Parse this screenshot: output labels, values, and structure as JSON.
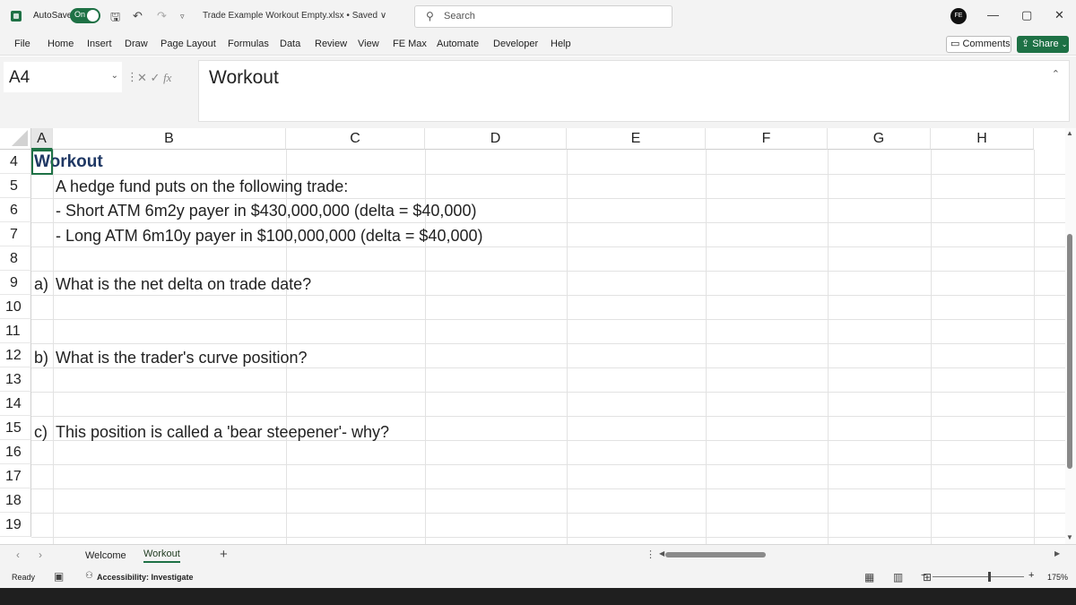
{
  "titlebar": {
    "autosave_label": "AutoSave",
    "autosave_state": "On",
    "doc_title": "Trade Example Workout Empty.xlsx • Saved ∨",
    "search_placeholder": "Search",
    "avatar_initials": "FE"
  },
  "ribbon": {
    "tabs": [
      "File",
      "Home",
      "Insert",
      "Draw",
      "Page Layout",
      "Formulas",
      "Data",
      "Review",
      "View",
      "FE Max",
      "Automate",
      "Developer",
      "Help"
    ],
    "comments_label": "Comments",
    "share_label": "Share"
  },
  "formula_bar": {
    "name_box": "A4",
    "fx_label": "fx",
    "content": "Workout"
  },
  "grid": {
    "columns": [
      "A",
      "B",
      "C",
      "D",
      "E",
      "F",
      "G",
      "H"
    ],
    "rows": [
      "4",
      "5",
      "6",
      "7",
      "8",
      "9",
      "10",
      "11",
      "12",
      "13",
      "14",
      "15",
      "16",
      "17",
      "18",
      "19"
    ],
    "cells": {
      "A4": "Workout",
      "B5": "A hedge fund puts on the following trade:",
      "B6": "- Short ATM 6m2y payer in $430,000,000 (delta = $40,000)",
      "B7": "- Long ATM 6m10y payer in $100,000,000 (delta = $40,000)",
      "A9": "a)",
      "B9": "What is the net delta on trade date?",
      "A12": "b)",
      "B12": "What is the trader's curve position?",
      "A15": "c)",
      "B15": "This position is called a 'bear steepener'- why?"
    }
  },
  "sheets": {
    "tabs": [
      "Welcome",
      "Workout"
    ],
    "active": "Workout"
  },
  "status": {
    "ready": "Ready",
    "accessibility": "Accessibility: Investigate",
    "zoom": "175%"
  },
  "colors": {
    "accent": "#1e7145",
    "heading_text": "#1f3864"
  }
}
